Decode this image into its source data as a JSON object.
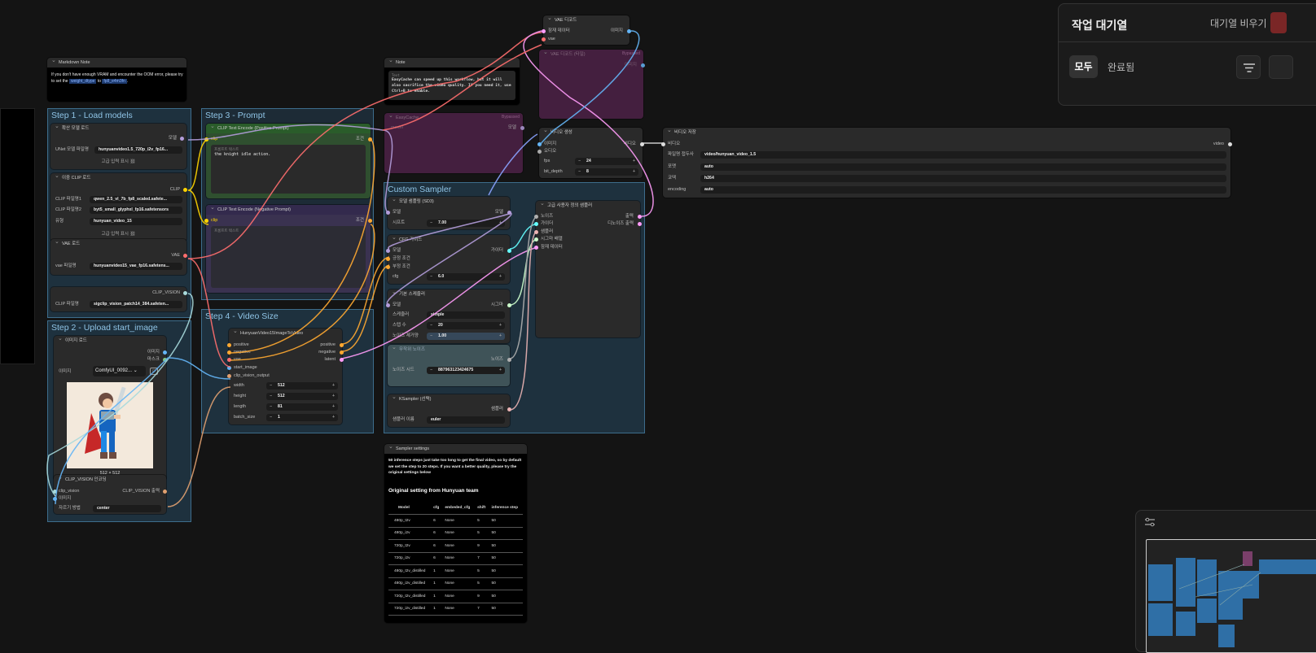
{
  "queue_panel": {
    "title": "작업 대기열",
    "clear_label": "대기열 비우기",
    "tab_all": "모두",
    "tab_completed": "완료됨",
    "filter_icon": "filter-icon"
  },
  "markdown_note": {
    "title": "Markdown Note",
    "text_prefix": "If you don't have enough VRAM and encounter the OOM error, please try to set the",
    "tag1": "weight_dtype",
    "text_mid": "to",
    "tag2": "fp8_e4m3fn",
    "text_suffix": "."
  },
  "groups": {
    "step1": "Step 1 - Load models",
    "step2": "Step 2 - Upload start_image",
    "step3": "Step 3 - Prompt",
    "step4": "Step 4 - Video Size",
    "custom_sampler": "Custom Sampler"
  },
  "diffusion_loader": {
    "title": "확산 모델 로드",
    "out_model": "모델",
    "unet_label": "UNet 모델 파일명",
    "unet_value": "hunyuanvideo1.5_720p_i2v_fp16...",
    "advanced": "고급 입력 표시"
  },
  "dual_clip": {
    "title": "이중 CLIP 로드",
    "out_clip": "CLIP",
    "clip1_label": "CLIP 파일명1",
    "clip1_value": "qwen_2.5_vl_7b_fp8_scaled.safete...",
    "clip2_label": "CLIP 파일명2",
    "clip2_value": "byt5_small_glyphxl_fp16.safetensors",
    "type_label": "유형",
    "type_value": "hunyuan_video_15",
    "advanced": "고급 입력 표시"
  },
  "vae_loader": {
    "title": "VAE 로드",
    "out_vae": "VAE",
    "vae_label": "vae 파일명",
    "vae_value": "hunyuanvideo15_vae_fp16.safetens..."
  },
  "clip_vision_loader": {
    "out": "CLIP_VISION",
    "label": "CLIP 파일명",
    "value": "sigclip_vision_patch14_384.safeten..."
  },
  "load_image": {
    "title": "이미지 로드",
    "out_image": "이미지",
    "out_mask": "마스크",
    "image_label": "이미지",
    "image_value": "ComfyUI_0092...",
    "size_caption": "512 × 512"
  },
  "clip_vision_encode": {
    "title": "CLIP_VISION 인코딩",
    "in_clip_vision": "clip_vision",
    "in_image": "이미지",
    "out": "CLIP_VISION 출력",
    "crop_label": "자르기 방법",
    "crop_value": "center"
  },
  "pos_prompt": {
    "title": "CLIP Text Encode (Positive Prompt)",
    "in_clip": "clip",
    "out": "조건",
    "placeholder": "프롬프트 텍스트",
    "text": "the knight idle action."
  },
  "neg_prompt": {
    "title": "CLIP Text Encode (Negative Prompt)",
    "in_clip": "clip",
    "out": "조건",
    "placeholder": "프롬프트 텍스트"
  },
  "hunyuan_i2v": {
    "title": "HunyuanVideo15ImageToVideo",
    "in_positive": "positive",
    "in_negative": "negative",
    "in_vae": "vae",
    "in_start_image": "start_image",
    "in_clip_vision_output": "clip_vision_output",
    "out_positive": "positive",
    "out_negative": "negative",
    "out_latent": "latent",
    "width_label": "width",
    "width": "512",
    "height_label": "height",
    "height": "512",
    "length_label": "length",
    "length": "81",
    "batch_label": "batch_size",
    "batch": "1"
  },
  "note": {
    "title": "Note",
    "label": "Text",
    "text": "EasyCache can speed up this workflow, but it will also sacrifice the video quality. If you need it, use Ctrl+B to enable."
  },
  "easycache": {
    "title": "EasyCache",
    "bypassed": "Bypassed",
    "in_model": "model",
    "out_model": "모델"
  },
  "vae_decode": {
    "title": "VAE 디코드",
    "in_latent": "잠재 데이터",
    "in_vae": "vae",
    "out_image": "이미지"
  },
  "vae_decode_tiled": {
    "title": "VAE 디코드 (타일)",
    "bypassed": "Bypassed",
    "out_image": "이미지"
  },
  "model_sampling": {
    "title": "모델 샘플링 (SD3)",
    "in_model": "모델",
    "out_model": "모델",
    "shift_label": "시프트",
    "shift": "7.00"
  },
  "cfg_guider": {
    "title": "CFG 가이드",
    "in_model": "모델",
    "in_pos": "긍정 조건",
    "in_neg": "부정 조건",
    "out_guider": "가이더",
    "cfg_label": "cfg",
    "cfg": "6.0"
  },
  "basic_scheduler": {
    "title": "기본 스케줄러",
    "in_model": "모델",
    "out_sigmas": "시그마",
    "scheduler_label": "스케줄러",
    "scheduler": "simple",
    "steps_label": "스텝 수",
    "steps": "20",
    "denoise_label": "노이즈 제거양",
    "denoise": "1.00"
  },
  "random_noise": {
    "title": "무작위 노이즈",
    "out_noise": "노이즈",
    "seed_label": "노이즈 시드",
    "seed": "887963123424675"
  },
  "ksampler_select": {
    "title": "KSampler (선택)",
    "out_sampler": "샘플러",
    "sampler_label": "샘플러 이름",
    "sampler": "euler"
  },
  "advanced_sampler": {
    "title": "고급 사용자 정의 샘플러",
    "in_noise": "노이즈",
    "in_guider": "가이더",
    "in_sampler": "샘플러",
    "in_sigmas": "시그마 배열",
    "in_latent": "잠재 데이터",
    "out_output": "출력",
    "out_denoised": "디노이즈 출력"
  },
  "create_video": {
    "title": "비디오 생성",
    "in_image": "이미지",
    "in_audio": "오디오",
    "out_video": "비디오",
    "fps_label": "fps",
    "fps": "24",
    "bit_label": "bit_depth",
    "bit": "8"
  },
  "save_video": {
    "title": "비디오 저장",
    "in_video": "비디오",
    "out_video": "video",
    "prefix_label": "파일명 접두사",
    "prefix": "video/hunyuan_video_1.5",
    "format_label": "포맷",
    "format": "auto",
    "codec_label": "코덱",
    "codec": "h264",
    "encoding_label": "encoding",
    "encoding": "auto"
  },
  "sampler_settings": {
    "title": "Sampler settings",
    "intro": "50 inference steps just take too long to get the final video, so by default we set the step to 20 steps. If you want a better quality, please try the original settings below",
    "heading": "Original setting from Hunyuan team",
    "columns": [
      "Model",
      "cfg",
      "embeded_cfg",
      "shift",
      "inference step"
    ],
    "rows": [
      [
        "480p_t2v",
        "6",
        "None",
        "5",
        "50"
      ],
      [
        "480p_i2v",
        "6",
        "None",
        "5",
        "50"
      ],
      [
        "720p_t2v",
        "6",
        "None",
        "9",
        "50"
      ],
      [
        "720p_i2v",
        "6",
        "None",
        "7",
        "50"
      ],
      [
        "480p_t2v_distilled",
        "1",
        "None",
        "5",
        "50"
      ],
      [
        "480p_i2v_distilled",
        "1",
        "None",
        "5",
        "50"
      ],
      [
        "720p_t2v_distilled",
        "1",
        "None",
        "9",
        "50"
      ],
      [
        "720p_i2v_distilled",
        "1",
        "None",
        "7",
        "50"
      ]
    ]
  },
  "colors": {
    "model": "#b39ddb",
    "clip": "#ffd500",
    "vae": "#ff6e6e",
    "conditioning": "#ffa931",
    "latent": "#ff9cf9",
    "image": "#64b5f6",
    "clip_vision": "#a8dadc",
    "noise": "#b0b0b0",
    "guider": "#66ffff",
    "sampler": "#ecb4b4",
    "sigmas": "#cdffcd",
    "video": "#ffffff"
  }
}
